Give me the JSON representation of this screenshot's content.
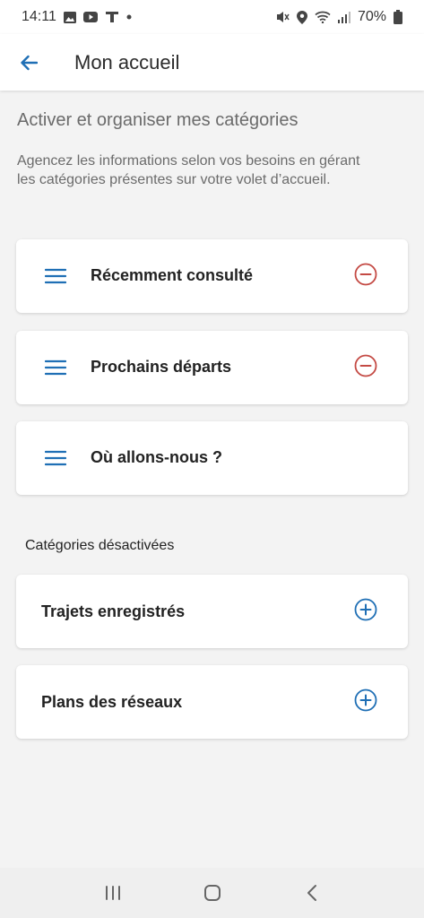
{
  "status_bar": {
    "time": "14:11",
    "battery": "70%"
  },
  "app_bar": {
    "title": "Mon accueil"
  },
  "header": {
    "title": "Activer et organiser mes catégories",
    "description": "Agencez les informations selon vos besoins en gérant les catégories présentes sur votre volet d’accueil."
  },
  "active_categories": [
    {
      "label": "Récemment consulté",
      "action": "remove"
    },
    {
      "label": "Prochains départs",
      "action": "remove"
    },
    {
      "label": "Où allons-nous ?",
      "action": "none"
    }
  ],
  "disabled_section": {
    "title": "Catégories désactivées",
    "items": [
      {
        "label": "Trajets enregistrés",
        "action": "add"
      },
      {
        "label": "Plans des réseaux",
        "action": "add"
      }
    ]
  },
  "colors": {
    "accent_blue": "#1f6fb5",
    "remove_red": "#c44a44",
    "background": "#f3f3f3"
  }
}
